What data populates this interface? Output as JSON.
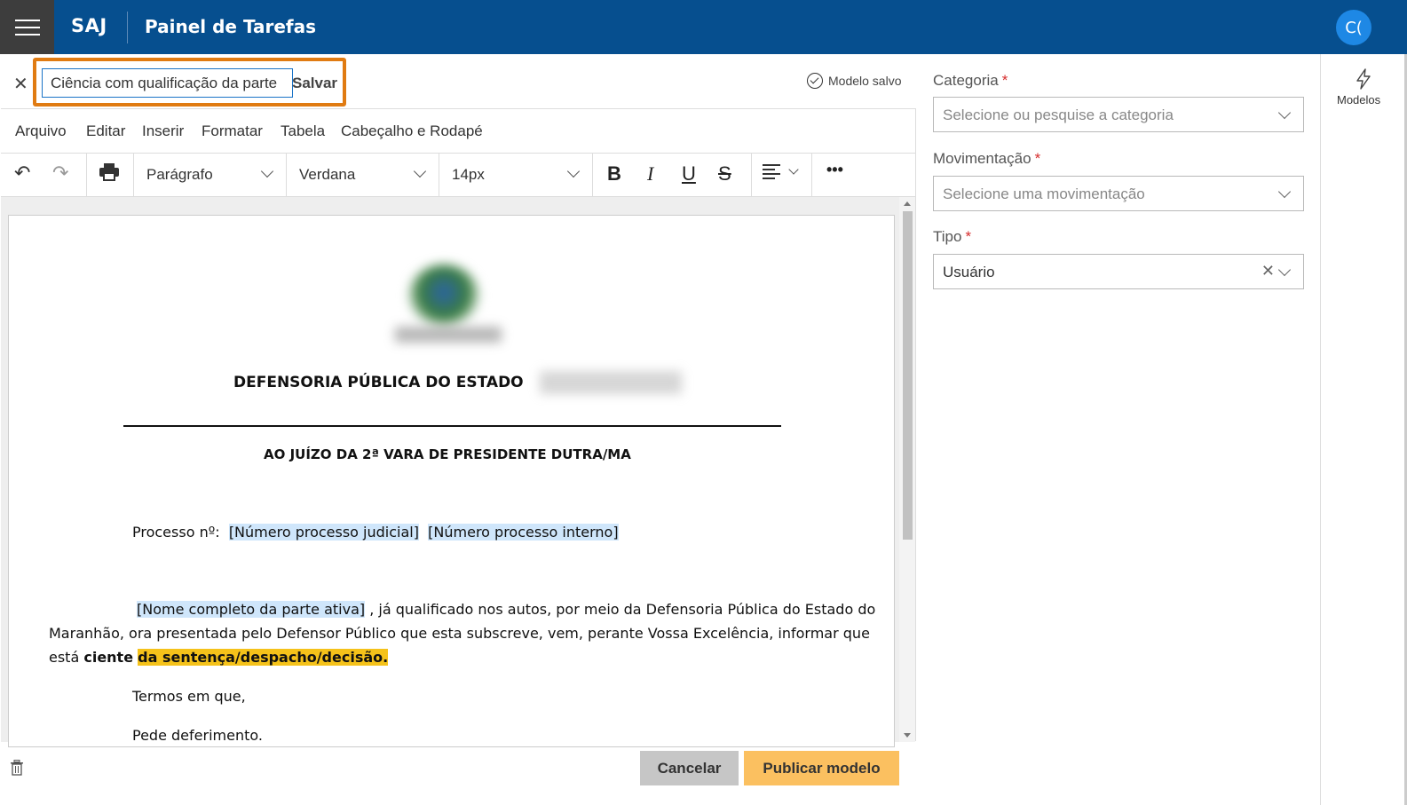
{
  "header": {
    "brand": "SAJ",
    "title": "Painel de Tarefas",
    "avatar_initials": "C("
  },
  "editor": {
    "title_value": "Ciência com qualificação da parte",
    "save_label": "Salvar",
    "saved_status": "Modelo salvo",
    "menu": [
      "Arquivo",
      "Editar",
      "Inserir",
      "Formatar",
      "Tabela",
      "Cabeçalho e Rodapé"
    ],
    "toolbar": {
      "block_format": "Parágrafo",
      "font_family": "Verdana",
      "font_size": "14px",
      "bold": "B",
      "italic": "I",
      "underline": "U",
      "strike": "S",
      "more": "•••"
    }
  },
  "document": {
    "heading": "DEFENSORIA PÚBLICA DO ESTADO",
    "court": "AO JUÍZO DA 2ª VARA DE PRESIDENTE DUTRA/MA",
    "process_label": "Processo nº:",
    "process_judicial": "[Número processo judicial]",
    "process_internal": "[Número processo interno]",
    "party_placeholder": "[Nome completo da parte ativa]",
    "body_line1": " , já qualificado nos autos, por meio da Defensoria Pública do Estado do",
    "body_line2": "Maranhão, ora presentada pelo Defensor Público que esta subscreve, vem, perante Vossa Excelência, informar que",
    "body_line3_prefix": "está ",
    "body_line3_bold": "ciente",
    "body_line3_highlight": "da sentença/despacho/decisão.",
    "closing1": "Termos em que,",
    "closing2": "Pede deferimento."
  },
  "actions": {
    "cancel": "Cancelar",
    "publish": "Publicar modelo"
  },
  "form": {
    "categoria_label": "Categoria",
    "categoria_placeholder": "Selecione ou pesquise a categoria",
    "movimentacao_label": "Movimentação",
    "movimentacao_placeholder": "Selecione uma movimentação",
    "tipo_label": "Tipo",
    "tipo_value": "Usuário",
    "required_mark": "*"
  },
  "rail": {
    "modelos_label": "Modelos"
  },
  "colors": {
    "header_bg": "#064f8f",
    "highlight_outline": "#e07b12",
    "publish_bg": "#fbc060",
    "placeholder_highlight": "#cfe6fb",
    "yellow_highlight": "#f5c21a"
  },
  "icons": [
    "hamburger-icon",
    "close-icon",
    "check-circle-icon",
    "undo-icon",
    "redo-icon",
    "print-icon",
    "align-left-icon",
    "trash-icon",
    "lightning-icon"
  ]
}
